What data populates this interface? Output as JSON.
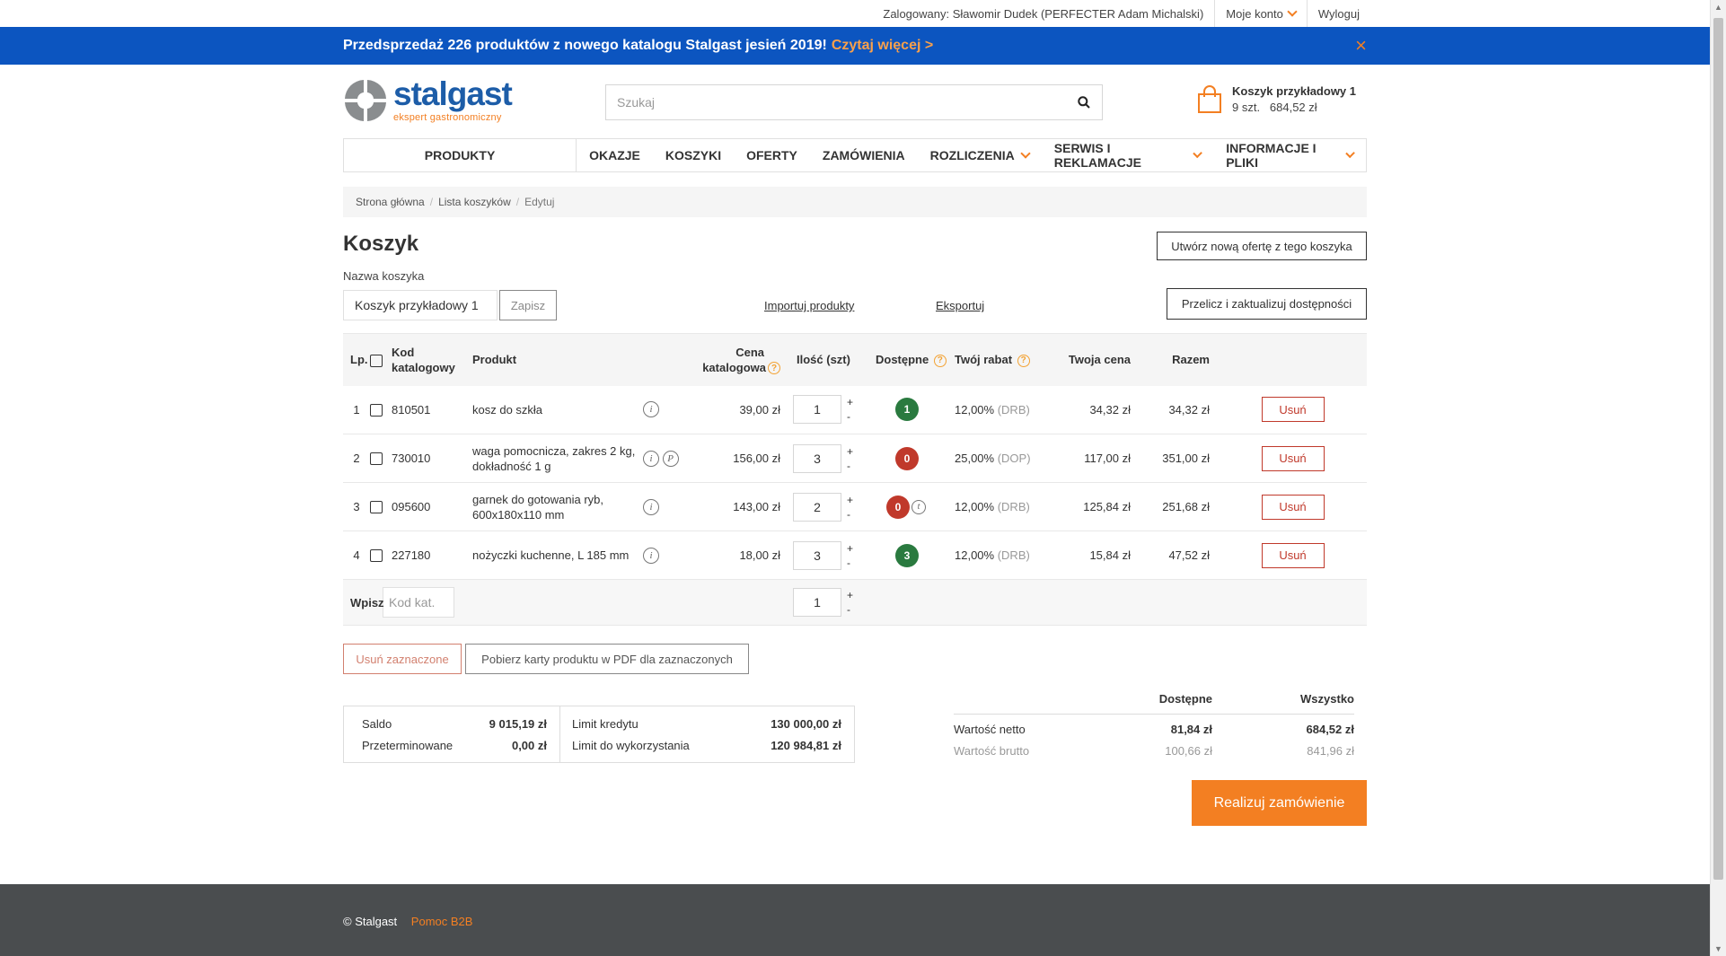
{
  "topbar": {
    "logged_in": "Zalogowany: Sławomir Dudek (PERFECTER Adam Michalski)",
    "my_account": "Moje konto",
    "logout": "Wyloguj"
  },
  "promo": {
    "text": "Przedsprzedaż 226 produktów z nowego katalogu Stalgast jesień 2019!",
    "link": "Czytaj więcej >",
    "close": "×"
  },
  "logo": {
    "name": "stalgast",
    "tagline": "ekspert gastronomiczny"
  },
  "search": {
    "placeholder": "Szukaj"
  },
  "cart": {
    "title": "Koszyk przykładowy 1",
    "info": "9 szt.   684,52 zł"
  },
  "nav": {
    "products": "PRODUKTY",
    "items": [
      {
        "label": "OKAZJE"
      },
      {
        "label": "KOSZYKI"
      },
      {
        "label": "OFERTY"
      },
      {
        "label": "ZAMÓWIENIA"
      },
      {
        "label": "ROZLICZENIA"
      },
      {
        "label": "SERWIS I REKLAMACJE"
      },
      {
        "label": "INFORMACJE I PLIKI"
      }
    ]
  },
  "breadcrumb": [
    "Strona główna",
    "Lista koszyków",
    "Edytuj"
  ],
  "page": {
    "title": "Koszyk",
    "new_offer": "Utwórz nową ofertę z tego koszyka",
    "name_label": "Nazwa koszyka",
    "name_value": "Koszyk przykładowy 1",
    "save": "Zapisz",
    "import": "Importuj produkty",
    "export": "Eksportuj",
    "recalc": "Przelicz i zaktualizuj dostępności"
  },
  "table": {
    "headers": {
      "lp": "Lp.",
      "kod1": "Kod",
      "kod2": "katalogowy",
      "produkt": "Produkt",
      "cena1": "Cena",
      "cena2": "katalogowa",
      "ilosc": "Ilość (szt)",
      "dostepne": "Dostępne",
      "rabat": "Twój rabat",
      "twoja_cena": "Twoja cena",
      "razem": "Razem"
    },
    "rows": [
      {
        "lp": "1",
        "kod": "810501",
        "produkt": "kosz do szkła",
        "cena": "39,00 zł",
        "ilosc": "1",
        "dost": "1",
        "rabat": "12,00%",
        "rabat_typ": "(DRB)",
        "twoja": "34,32 zł",
        "razem": "34,32 zł",
        "remove": "Usuń"
      },
      {
        "lp": "2",
        "kod": "730010",
        "produkt": "waga pomocnicza, zakres 2 kg, dokładność 1 g",
        "cena": "156,00 zł",
        "ilosc": "3",
        "dost": "0",
        "rabat": "25,00%",
        "rabat_typ": "(DOP)",
        "twoja": "117,00 zł",
        "razem": "351,00 zł",
        "remove": "Usuń"
      },
      {
        "lp": "3",
        "kod": "095600",
        "produkt": "garnek do gotowania ryb, 600x180x110 mm",
        "cena": "143,00 zł",
        "ilosc": "2",
        "dost": "0",
        "rabat": "12,00%",
        "rabat_typ": "(DRB)",
        "twoja": "125,84 zł",
        "razem": "251,68 zł",
        "remove": "Usuń"
      },
      {
        "lp": "4",
        "kod": "227180",
        "produkt": "nożyczki kuchenne, L 185 mm",
        "cena": "18,00 zł",
        "ilosc": "3",
        "dost": "3",
        "rabat": "12,00%",
        "rabat_typ": "(DRB)",
        "twoja": "15,84 zł",
        "razem": "47,52 zł",
        "remove": "Usuń"
      }
    ],
    "add_row": {
      "label": "Wpisz",
      "placeholder": "Kod kat.",
      "qty": "1"
    },
    "plus": "+",
    "minus": "-"
  },
  "bulk": {
    "delete": "Usuń zaznaczone",
    "pdf": "Pobierz karty produktu w PDF dla zaznaczonych"
  },
  "balance": {
    "saldo_label": "Saldo",
    "saldo": "9 015,19 zł",
    "overdue_label": "Przeterminowane",
    "overdue": "0,00 zł",
    "limit_label": "Limit kredytu",
    "limit": "130 000,00 zł",
    "avail_label": "Limit do wykorzystania",
    "avail": "120 984,81 zł"
  },
  "totals": {
    "h_avail": "Dostępne",
    "h_all": "Wszystko",
    "netto_label": "Wartość netto",
    "netto_avail": "81,84 zł",
    "netto_all": "684,52 zł",
    "brutto_label": "Wartość brutto",
    "brutto_avail": "100,66 zł",
    "brutto_all": "841,96 zł"
  },
  "order": "Realizuj zamówienie",
  "footer": {
    "copyright": "© Stalgast",
    "help": "Pomoc B2B"
  },
  "colors": {
    "brand_blue": "#0c55c0",
    "accent_orange": "#f37f22",
    "danger": "#c0392b",
    "ok": "#2a7a3f"
  }
}
